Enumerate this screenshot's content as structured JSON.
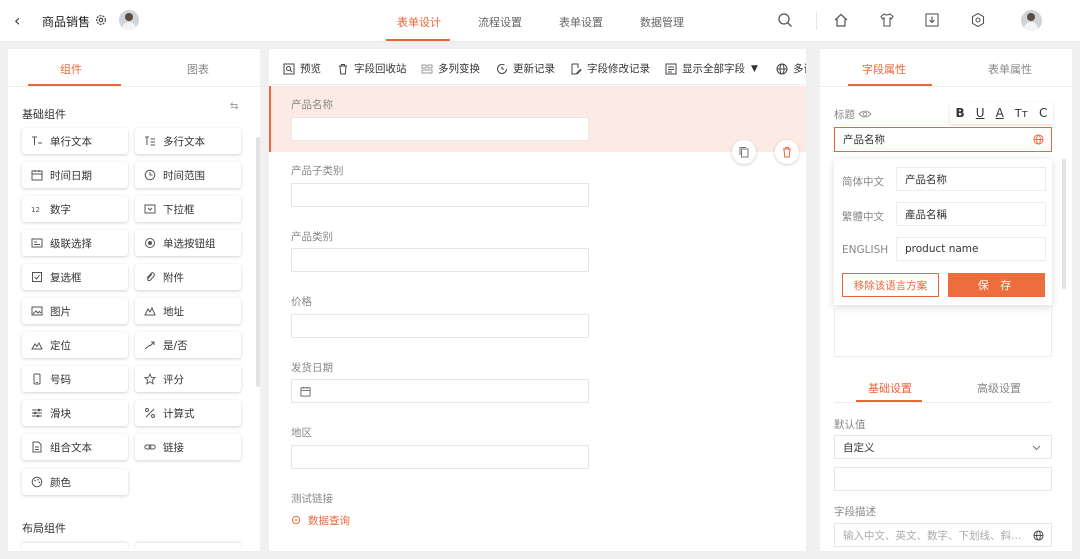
{
  "header": {
    "title": "商品销售",
    "tabs": [
      {
        "label": "表单设计",
        "active": true
      },
      {
        "label": "流程设置",
        "active": false
      },
      {
        "label": "表单设置",
        "active": false
      },
      {
        "label": "数据管理",
        "active": false
      }
    ]
  },
  "left": {
    "tabs": [
      "组件",
      "图表"
    ],
    "basic_title": "基础组件",
    "layout_title": "布局组件",
    "components": [
      "单行文本",
      "多行文本",
      "时间日期",
      "时间范围",
      "数字",
      "下拉框",
      "级联选择",
      "单选按钮组",
      "复选框",
      "附件",
      "图片",
      "地址",
      "定位",
      "是/否",
      "号码",
      "评分",
      "滑块",
      "计算式",
      "组合文本",
      "链接",
      "颜色"
    ]
  },
  "toolbar": {
    "items": [
      "预览",
      "字段回收站",
      "多列变换",
      "更新记录",
      "字段修改记录",
      "显示全部字段",
      "多语"
    ]
  },
  "form": {
    "fields": [
      "产品名称",
      "产品子类别",
      "产品类别",
      "价格",
      "发货日期",
      "地区",
      "测试链接"
    ],
    "link_text": "数据查询"
  },
  "right": {
    "tabs": [
      "字段属性",
      "表单属性"
    ],
    "title_label": "标题",
    "title_value": "产品名称",
    "format": [
      "B",
      "U",
      "A",
      "Tт",
      "C"
    ],
    "languages": [
      {
        "label": "简体中文",
        "value": "产品名称"
      },
      {
        "label": "繁體中文",
        "value": "產品名稱"
      },
      {
        "label": "ENGLISH",
        "value": "product name"
      }
    ],
    "remove_label": "移除该语言方案",
    "save_label": "保 存",
    "sub_tabs": [
      "基础设置",
      "高级设置"
    ],
    "default_label": "默认值",
    "default_value": "自定义",
    "desc_label": "字段描述",
    "desc_placeholder": "输入中文、英文、数字、下划线、斜…"
  },
  "colors": {
    "accent": "#e8673a"
  }
}
